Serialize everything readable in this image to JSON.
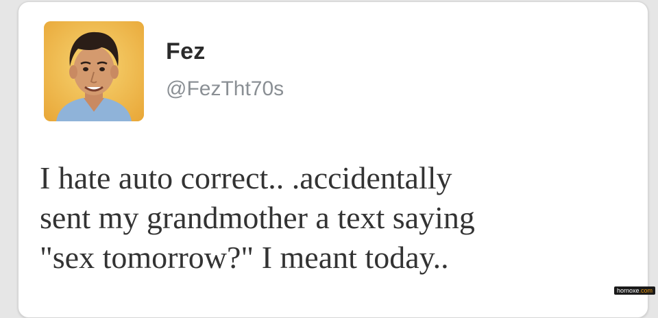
{
  "tweet": {
    "display_name": "Fez",
    "handle": "@FezTht70s",
    "text_lines": [
      "I hate auto correct.. .accidentally",
      "sent my grandmother a text saying",
      "\"sex tomorrow?\" I meant today.."
    ],
    "avatar_icon": "profile-photo"
  },
  "watermark": {
    "main": "hornoxe",
    "accent": ".com"
  },
  "colors": {
    "background": "#e6e6e6",
    "card": "#ffffff",
    "name": "#2b2b2b",
    "handle": "#8a8f94",
    "text": "#333333",
    "avatar_bg": "#f2c14e"
  }
}
